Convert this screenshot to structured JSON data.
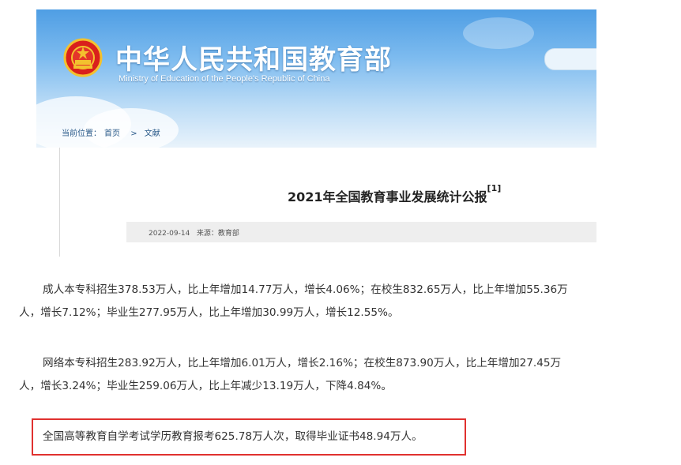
{
  "header": {
    "title_cn": "中华人民共和国教育部",
    "title_en": "Ministry of Education of the People's Republic of China",
    "emblem_icon": "national-emblem-icon"
  },
  "breadcrumb": {
    "prefix": "当前位置：",
    "home": "首页",
    "separator": ">",
    "section": "文献"
  },
  "document": {
    "title": "2021年全国教育事业发展统计公报",
    "footnote": "[1]",
    "date": "2022-09-14",
    "source": "来源：教育部"
  },
  "paragraphs": {
    "p1_line1": "成人本专科招生378.53万人，比上年增加14.77万人，增长4.06%；在校生832.65万人，比上年增加55.36万",
    "p1_line2": "人，增长7.12%；毕业生277.95万人，比上年增加30.99万人，增长12.55%。",
    "p2_line1": "网络本专科招生283.92万人，比上年增加6.01万人，增长2.16%；在校生873.90万人，比上年增加27.45万",
    "p2_line2": "人，增长3.24%；毕业生259.06万人，比上年减少13.19万人，下降4.84%。",
    "p3": "全国高等教育自学考试学历教育报考625.78万人次，取得毕业证书48.94万人。"
  },
  "colors": {
    "banner_top": "#4f9ee4",
    "highlight_border": "#e0312f",
    "meta_bar": "#eeeeee"
  }
}
